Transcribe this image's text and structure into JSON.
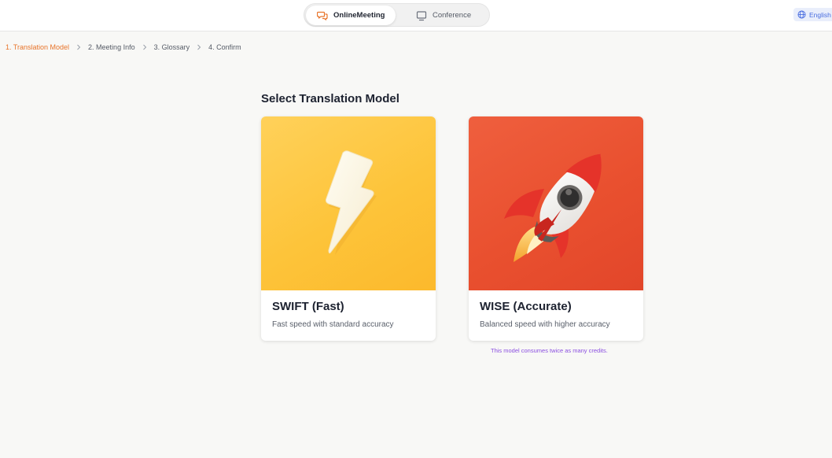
{
  "header": {
    "tabs": [
      {
        "label": "OnlineMeeting",
        "icon": "chat-bubbles-icon",
        "active": true
      },
      {
        "label": "Conference",
        "icon": "monitor-icon",
        "active": false
      }
    ],
    "language": {
      "label": "English",
      "icon": "globe-icon"
    }
  },
  "breadcrumb": {
    "steps": [
      "1. Translation Model",
      "2. Meeting Info",
      "3. Glossary",
      "4. Confirm"
    ],
    "active_index": 0
  },
  "main": {
    "title": "Select Translation Model",
    "models": [
      {
        "name": "SWIFT (Fast)",
        "description": "Fast speed with standard accuracy",
        "icon": "lightning-bolt-icon"
      },
      {
        "name": "WISE (Accurate)",
        "description": "Balanced speed with higher accuracy",
        "icon": "rocket-icon"
      }
    ],
    "note": "This model consumes twice as many credits."
  },
  "colors": {
    "accent": "#e8742a",
    "swift_card": "#fdc43a",
    "wise_card": "#e9502f",
    "note_text": "#8b4fe0",
    "language_text": "#4a6ee0"
  }
}
